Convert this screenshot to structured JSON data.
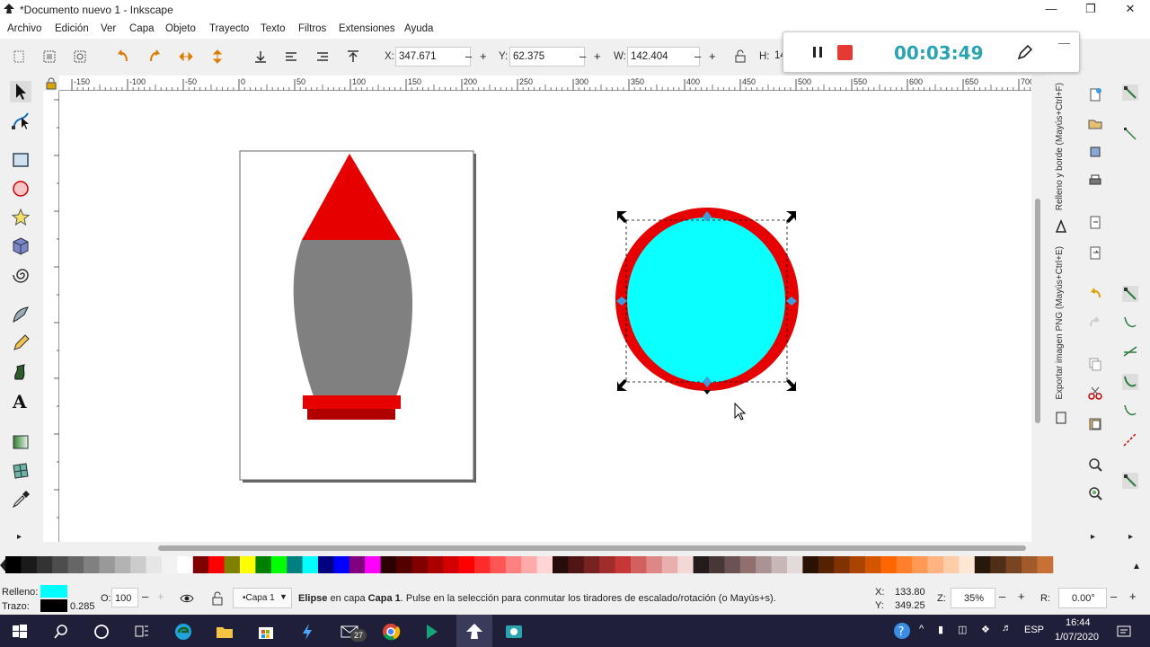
{
  "window": {
    "title": "*Documento nuevo 1 - Inkscape"
  },
  "menu": [
    "Archivo",
    "Edición",
    "Ver",
    "Capa",
    "Objeto",
    "Trayecto",
    "Texto",
    "Filtros",
    "Extensiones",
    "Ayuda"
  ],
  "toolbar": {
    "x_label": "X:",
    "x_value": "347.671",
    "y_label": "Y:",
    "y_value": "62.375",
    "w_label": "W:",
    "w_value": "142.404",
    "h_label": "H:",
    "h_value": "14"
  },
  "recorder": {
    "time": "00:03:49"
  },
  "ruler_labels": [
    "-150",
    "-100",
    "-50",
    "0",
    "50",
    "100",
    "150",
    "200",
    "250",
    "300",
    "350",
    "400",
    "450",
    "500",
    "550",
    "600",
    "650",
    "700"
  ],
  "dock": {
    "fill_stroke_tab": "Relleno y borde (Mayús+Ctrl+F)",
    "export_tab": "Exportar imagen PNG (Mayús+Ctrl+E)"
  },
  "palette": {
    "colors": [
      "#000000",
      "#1a1a1a",
      "#333333",
      "#4d4d4d",
      "#666666",
      "#808080",
      "#999999",
      "#b3b3b3",
      "#cccccc",
      "#e6e6e6",
      "#f2f2f2",
      "#ffffff",
      "#800000",
      "#ff0000",
      "#808000",
      "#ffff00",
      "#008000",
      "#00ff00",
      "#008080",
      "#00ffff",
      "#000080",
      "#0000ff",
      "#800080",
      "#ff00ff",
      "#2b0000",
      "#550000",
      "#800000",
      "#aa0000",
      "#d40000",
      "#ff0000",
      "#ff2a2a",
      "#ff5555",
      "#ff8080",
      "#ffaaaa",
      "#ffd5d5",
      "#280b0b",
      "#501616",
      "#782121",
      "#a02c2c",
      "#c83737",
      "#d35f5f",
      "#de8787",
      "#e9afaf",
      "#f4d7d7",
      "#241c1c",
      "#483737",
      "#6c5353",
      "#916f6f",
      "#ac9393",
      "#c8b7b7",
      "#e3dbdb",
      "#2b1100",
      "#552200",
      "#803300",
      "#aa4400",
      "#d45500",
      "#ff6600",
      "#ff7f2a",
      "#ff9955",
      "#ffb380",
      "#ffccaa",
      "#ffe6d5",
      "#28170b",
      "#502d16",
      "#784421",
      "#a05a2c",
      "#c87137"
    ]
  },
  "status": {
    "fill_label": "Relleno:",
    "fill_color": "#00ffff",
    "stroke_label": "Trazo:",
    "stroke_color": "#000000",
    "stroke_width": "0.285",
    "opacity_label": "O:",
    "opacity_value": "100",
    "layer": "•Capa 1",
    "message_bold": "Elipse",
    "message_1": " en capa ",
    "message_layer": "Capa 1",
    "message_2": ". Pulse en la selección para conmutar los tiradores de escalado/rotación (o Mayús+s).",
    "cursor_x_label": "X:",
    "cursor_x": "133.80",
    "cursor_y_label": "Y:",
    "cursor_y": "349.25",
    "zoom_label": "Z:",
    "zoom": "35%",
    "rotation_label": "R:",
    "rotation": "0.00°"
  },
  "taskbar": {
    "lang": "ESP",
    "time": "16:44",
    "date": "1/07/2020",
    "mail_badge": "27"
  },
  "colors": {
    "red": "#e60000",
    "cyan": "#0affff",
    "gray": "#808080",
    "darkred": "#b00000",
    "recorder_time": "#2aa4b0",
    "record_red": "#e53935"
  }
}
